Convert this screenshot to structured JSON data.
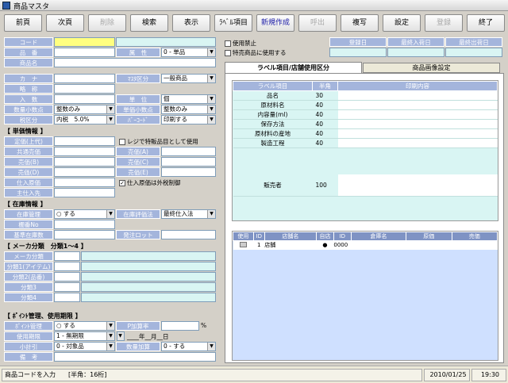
{
  "window": {
    "title": "商品マスタ"
  },
  "toolbar": {
    "buttons": [
      "前頁",
      "次頁",
      "削除",
      "検索",
      "表示",
      "ﾗﾍﾞﾙ項目",
      "新規作成",
      "呼出",
      "複写",
      "設定",
      "登録",
      "終了"
    ]
  },
  "form": {
    "code_label": "コード",
    "hinban_label": "品　番",
    "zokusei_label": "属　性",
    "zokusei_value": "0 - 単品",
    "name_label": "商品名",
    "kana_label": "カ　ナ",
    "mark_label": "ﾏｽﾀ区分",
    "mark_value": "一般商品",
    "ryakusho_label": "略　称",
    "unit_label": "単　位",
    "unit_value": "個",
    "irisu_label": "入　数",
    "qty_dec_label": "数量小数点",
    "qty_dec_value": "整数のみ",
    "price_dec_label": "単価小数点",
    "price_dec_value": "整数のみ",
    "tax_label": "税区分",
    "tax_value": "内税　5.0%",
    "barcode_label": "ﾊﾞｰｺｰﾄﾞ",
    "barcode_value": "印刷する"
  },
  "price": {
    "section": "【 単価情報 】",
    "teika_label": "定価(上代)",
    "common_label": "共通売価",
    "b_label": "売価(B)",
    "d_label": "売価(D)",
    "shiire_label": "仕入原価",
    "main_supplier_label": "主仕入先",
    "a_label": "売価(A)",
    "c_label": "売価(C)",
    "e_label": "売価(E)",
    "register_exclude": "レジで特販品目として使用",
    "shiire_tax": "仕入原価は外税制御"
  },
  "stock": {
    "section": "【 在庫情報 】",
    "manage_label": "在庫管理",
    "manage_value": "○ する",
    "eval_label": "在庫評価法",
    "eval_value": "最終仕入法",
    "shelf_label": "棚番No",
    "base_label": "基準在庫数",
    "lot_label": "発注ロット"
  },
  "maker": {
    "section": "【 メーカ分類　分類1～4 】",
    "maker_label": "メーカ分類",
    "c1_label": "分類1(アイテム)",
    "c2_label": "分類2(品番)",
    "c3_label": "分類3",
    "c4_label": "分類4"
  },
  "point": {
    "section": "【 ﾎﾟｲﾝﾄ管理、使用期限 】",
    "manage_label": "ﾎﾟｲﾝﾄ管理",
    "manage_value": "○ する",
    "rate_label": "P加算率",
    "rate_unit": "%",
    "expiry_label": "使用期限",
    "expiry_value": "1 - 無期限",
    "date_value": "____年__月__日",
    "discount_label": "小計引",
    "discount_value": "0 - 対象品",
    "qty_add_label": "数量加算",
    "qty_add_value": "0 - する",
    "remarks_label": "備　考"
  },
  "flags": {
    "disable": "使用禁止",
    "special": "特売商品に使用する"
  },
  "dates": {
    "headers": [
      "登録日",
      "最終入荷日",
      "最終出荷日"
    ]
  },
  "tabs": [
    "ラベル項目/店舗使用区分",
    "商品画像設定"
  ],
  "label_table": {
    "headers": [
      "ラベル項目",
      "半角",
      "印刷内容"
    ],
    "rows": [
      {
        "item": "品名",
        "width": "30"
      },
      {
        "item": "原材料名",
        "width": "40"
      },
      {
        "item": "内容量(ml)",
        "width": "40"
      },
      {
        "item": "保存方法",
        "width": "40"
      },
      {
        "item": "原材料の産地",
        "width": "40"
      },
      {
        "item": "製造工程",
        "width": "40"
      },
      {
        "item": "販売者",
        "width": "100"
      }
    ]
  },
  "store_table": {
    "headers": [
      "使用",
      "ID",
      "店舗名",
      "自店",
      "ID",
      "倉庫名",
      "原価",
      "売価"
    ],
    "rows": [
      {
        "use": "",
        "id": "1",
        "name": "店舗",
        "own": "●",
        "wid": "0000"
      }
    ]
  },
  "status": {
    "message": "商品コードを入力",
    "hint": "[半角：16桁]",
    "date": "2010/01/25",
    "time": "19:30"
  },
  "colors": {
    "label_bg": "#a4b5dc",
    "code_field": "#ffff80",
    "cyan_field": "#d9f5f3"
  }
}
